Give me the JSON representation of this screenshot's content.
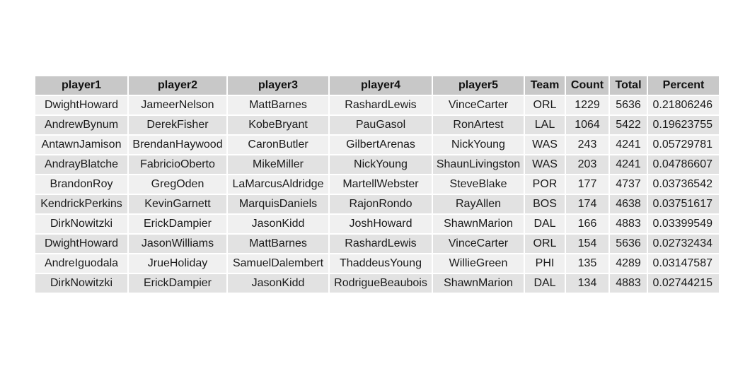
{
  "chart_data": {
    "type": "table",
    "columns": [
      "player1",
      "player2",
      "player3",
      "player4",
      "player5",
      "Team",
      "Count",
      "Total",
      "Percent"
    ],
    "rows": [
      [
        "DwightHoward",
        "JameerNelson",
        "MattBarnes",
        "RashardLewis",
        "VinceCarter",
        "ORL",
        "1229",
        "5636",
        "0.21806246"
      ],
      [
        "AndrewBynum",
        "DerekFisher",
        "KobeBryant",
        "PauGasol",
        "RonArtest",
        "LAL",
        "1064",
        "5422",
        "0.19623755"
      ],
      [
        "AntawnJamison",
        "BrendanHaywood",
        "CaronButler",
        "GilbertArenas",
        "NickYoung",
        "WAS",
        "243",
        "4241",
        "0.05729781"
      ],
      [
        "AndrayBlatche",
        "FabricioOberto",
        "MikeMiller",
        "NickYoung",
        "ShaunLivingston",
        "WAS",
        "203",
        "4241",
        "0.04786607"
      ],
      [
        "BrandonRoy",
        "GregOden",
        "LaMarcusAldridge",
        "MartellWebster",
        "SteveBlake",
        "POR",
        "177",
        "4737",
        "0.03736542"
      ],
      [
        "KendrickPerkins",
        "KevinGarnett",
        "MarquisDaniels",
        "RajonRondo",
        "RayAllen",
        "BOS",
        "174",
        "4638",
        "0.03751617"
      ],
      [
        "DirkNowitzki",
        "ErickDampier",
        "JasonKidd",
        "JoshHoward",
        "ShawnMarion",
        "DAL",
        "166",
        "4883",
        "0.03399549"
      ],
      [
        "DwightHoward",
        "JasonWilliams",
        "MattBarnes",
        "RashardLewis",
        "VinceCarter",
        "ORL",
        "154",
        "5636",
        "0.02732434"
      ],
      [
        "AndreIguodala",
        "JrueHoliday",
        "SamuelDalembert",
        "ThaddeusYoung",
        "WillieGreen",
        "PHI",
        "135",
        "4289",
        "0.03147587"
      ],
      [
        "DirkNowitzki",
        "ErickDampier",
        "JasonKidd",
        "RodrigueBeaubois",
        "ShawnMarion",
        "DAL",
        "134",
        "4883",
        "0.02744215"
      ]
    ]
  }
}
